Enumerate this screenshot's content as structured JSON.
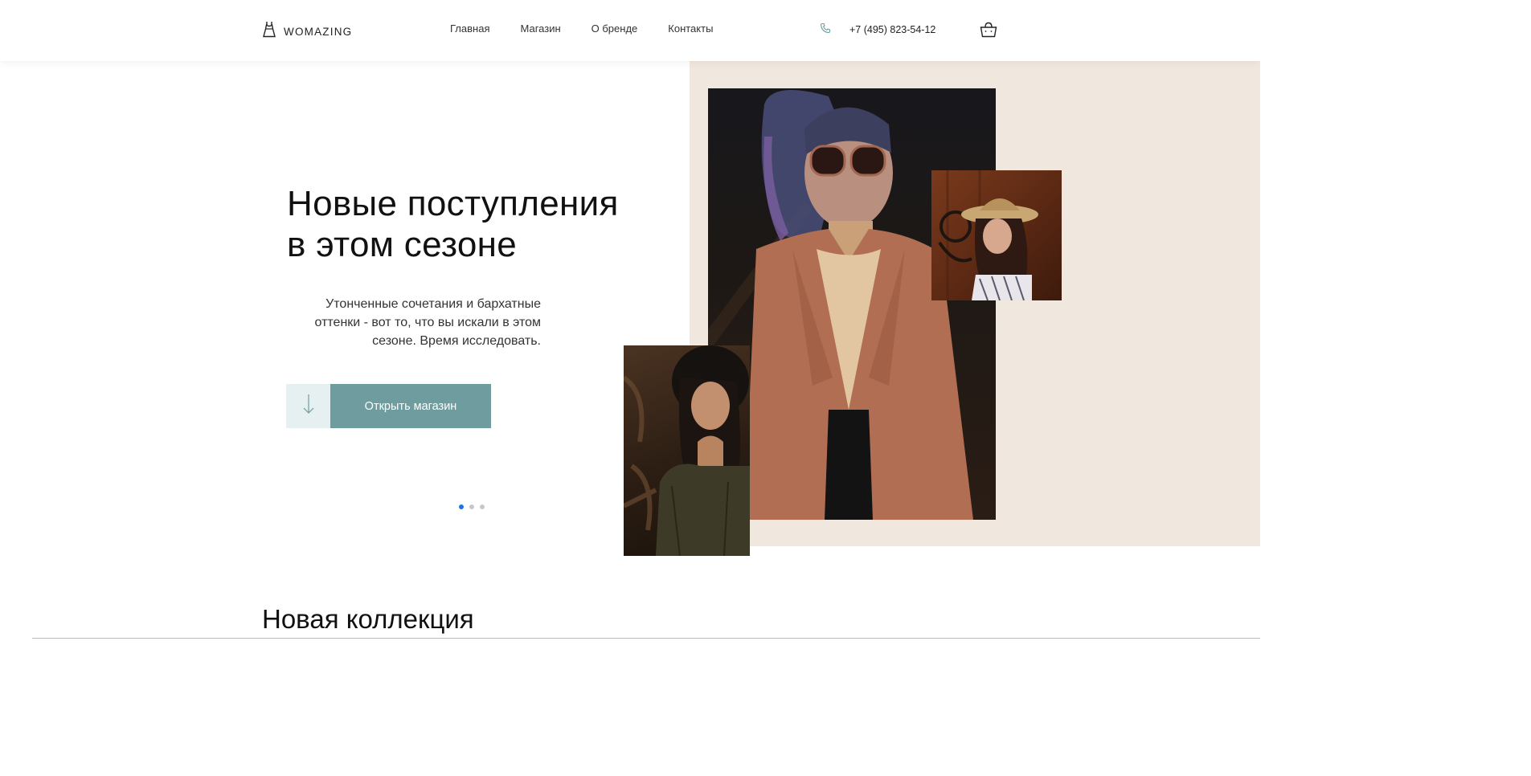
{
  "header": {
    "logo_text": "WOMAZING",
    "nav": [
      "Главная",
      "Магазин",
      "О бренде",
      "Контакты"
    ],
    "phone": "+7 (495) 823-54-12"
  },
  "hero": {
    "title_line1": "Новые поступления",
    "title_line2": "в этом сезоне",
    "subtitle": "Утонченные сочетания и бархатные оттенки - вот то, что вы искали в этом сезоне. Время исследовать.",
    "button_label": "Открыть магазин",
    "slides_total": 3,
    "active_slide": 1
  },
  "collection": {
    "title": "Новая коллекция"
  },
  "colors": {
    "accent": "#6e9c9f",
    "accent_light": "#e6f0f0",
    "beige": "#f0e8df",
    "active_dot": "#1a73e8"
  },
  "icons": {
    "logo": "dress-icon",
    "phone": "phone-icon",
    "cart": "shopping-basket-icon",
    "arrow": "arrow-down-icon"
  }
}
